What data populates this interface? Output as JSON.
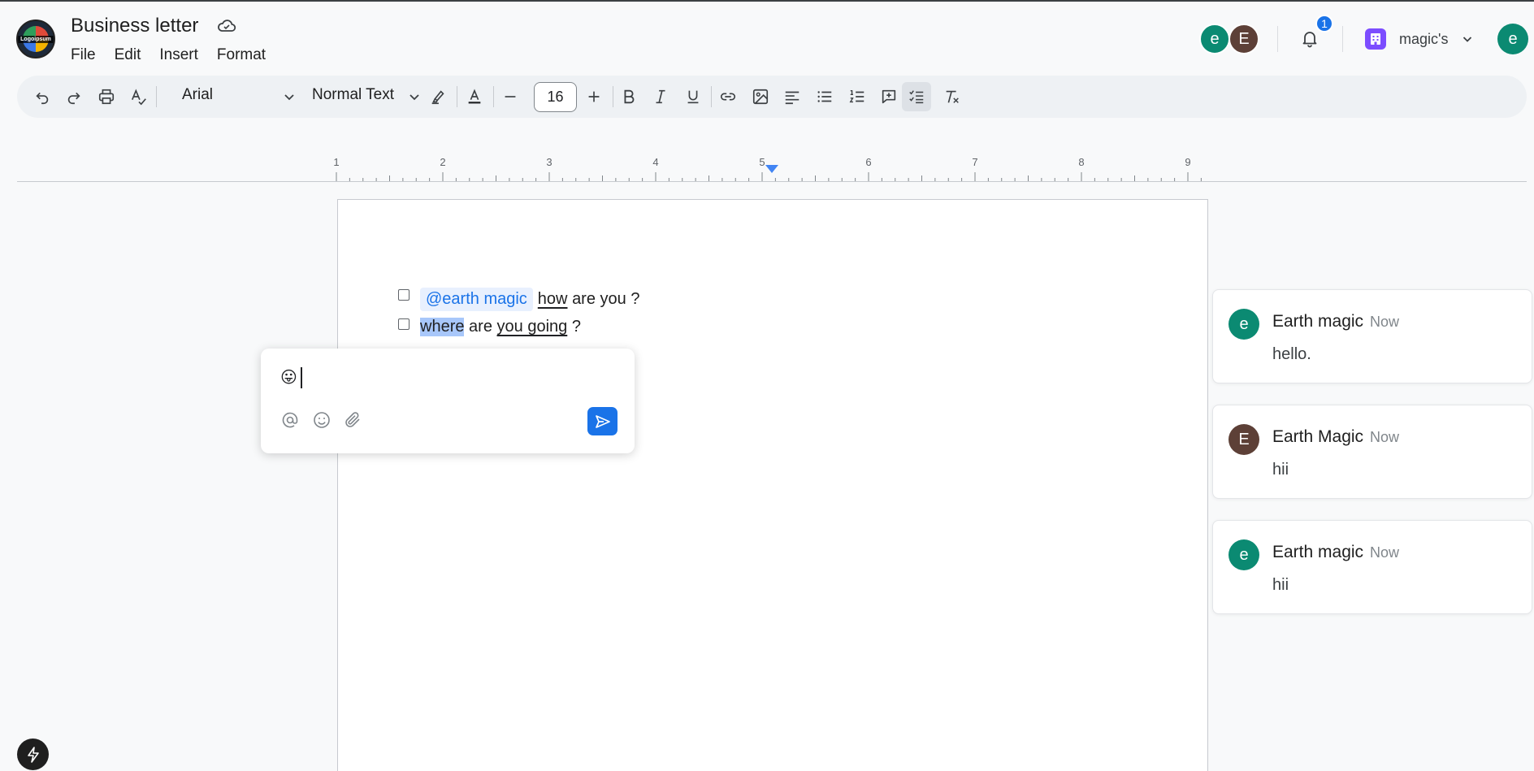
{
  "header": {
    "logo_text": "Logoipsum",
    "title": "Business letter",
    "menu": [
      "File",
      "Edit",
      "Insert",
      "Format"
    ],
    "collaborators": [
      "e",
      "E"
    ],
    "notification_count": "1",
    "workspace_name": "magic's",
    "user_initial": "e"
  },
  "toolbar": {
    "font": "Arial",
    "text_style": "Normal Text",
    "font_size": "16"
  },
  "ruler": {
    "numbers": [
      "1",
      "2",
      "3",
      "4",
      "5",
      "6",
      "7",
      "8",
      "9"
    ]
  },
  "document": {
    "line1": {
      "mention": "@earth magic",
      "word": "how",
      "rest": "are you ?"
    },
    "line2": {
      "highlighted": "where",
      "mid": "are",
      "underlined": "you going",
      "end": "?"
    }
  },
  "composer": {
    "emoji": "😛"
  },
  "comments": [
    {
      "initial": "e",
      "author": "Earth magic",
      "time": "Now",
      "text": "hello.",
      "color": "#0b8a72"
    },
    {
      "initial": "E",
      "author": "Earth Magic",
      "time": "Now",
      "text": "hii",
      "color": "#5d4037"
    },
    {
      "initial": "e",
      "author": "Earth magic",
      "time": "Now",
      "text": "hii",
      "color": "#0b8a72"
    }
  ],
  "colors": {
    "accent": "#1a73e8",
    "teal": "#0b8a72",
    "brown": "#5d4037",
    "workspace": "#7c4dff"
  }
}
